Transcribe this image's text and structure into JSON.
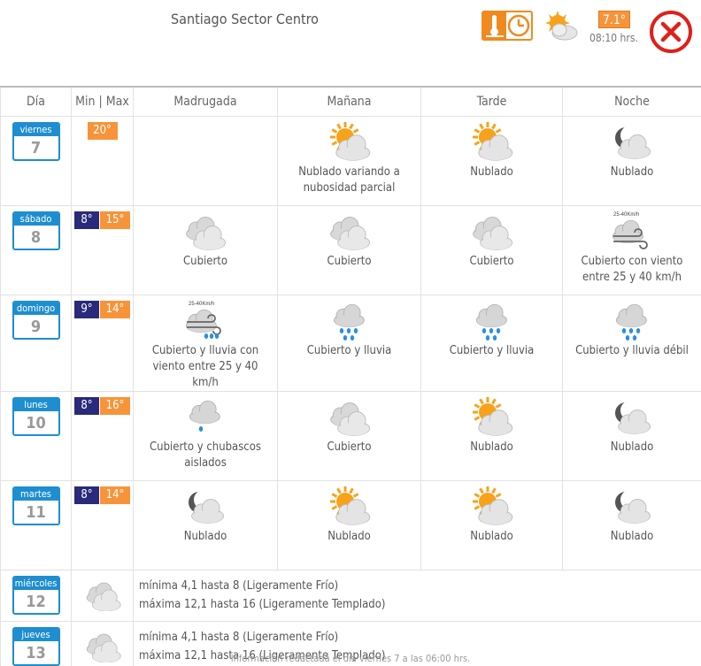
{
  "header": {
    "station": "Santiago Sector Centro",
    "current_temp": "7.1°",
    "current_time": "08:10 hrs.",
    "icons": {
      "temp_clock": "thermometer-clock-icon",
      "current": "partly-cloudy-icon",
      "close": "close-icon"
    }
  },
  "columns": [
    "Día",
    "Min | Max",
    "Madrugada",
    "Mañana",
    "Tarde",
    "Noche"
  ],
  "days": [
    {
      "name": "viernes",
      "date": "7",
      "min": "",
      "max": "20°",
      "periods": [
        {
          "icon": "",
          "text": ""
        },
        {
          "icon": "partly-cloudy",
          "text": "Nublado variando a nubosidad parcial"
        },
        {
          "icon": "partly-cloudy",
          "text": "Nublado"
        },
        {
          "icon": "cloudy-night",
          "text": "Nublado"
        }
      ]
    },
    {
      "name": "sábado",
      "date": "8",
      "min": "8°",
      "max": "15°",
      "periods": [
        {
          "icon": "overcast",
          "text": "Cubierto"
        },
        {
          "icon": "overcast",
          "text": "Cubierto"
        },
        {
          "icon": "overcast",
          "text": "Cubierto"
        },
        {
          "icon": "wind",
          "text": "Cubierto con viento entre 25 y 40 km/h",
          "wind": "25-40Km/h"
        }
      ]
    },
    {
      "name": "domingo",
      "date": "9",
      "min": "9°",
      "max": "14°",
      "periods": [
        {
          "icon": "wind-rain",
          "text": "Cubierto y lluvia con viento entre 25 y 40 km/h",
          "wind": "25-40Km/h"
        },
        {
          "icon": "rain",
          "text": "Cubierto y lluvia"
        },
        {
          "icon": "rain",
          "text": "Cubierto y lluvia"
        },
        {
          "icon": "rain",
          "text": "Cubierto y lluvia débil"
        }
      ]
    },
    {
      "name": "lunes",
      "date": "10",
      "min": "8°",
      "max": "16°",
      "periods": [
        {
          "icon": "showers",
          "text": "Cubierto y chubascos aislados"
        },
        {
          "icon": "overcast",
          "text": "Cubierto"
        },
        {
          "icon": "partly-cloudy",
          "text": "Nublado"
        },
        {
          "icon": "cloudy-night",
          "text": "Nublado"
        }
      ]
    },
    {
      "name": "martes",
      "date": "11",
      "min": "8°",
      "max": "14°",
      "periods": [
        {
          "icon": "cloudy-night",
          "text": "Nublado"
        },
        {
          "icon": "partly-cloudy",
          "text": "Nublado"
        },
        {
          "icon": "partly-cloudy",
          "text": "Nublado"
        },
        {
          "icon": "cloudy-night",
          "text": "Nublado"
        }
      ]
    }
  ],
  "long_range": [
    {
      "name": "miércoles",
      "date": "12",
      "icon": "overcast-small",
      "line1": "mínima 4,1 hasta 8 (Ligeramente Frío)",
      "line2": "máxima 12,1 hasta 16 (Ligeramente Templado)"
    },
    {
      "name": "jueves",
      "date": "13",
      "icon": "overcast-small",
      "line1": "mínima 4,1 hasta 8 (Ligeramente Frío)",
      "line2": "máxima 12,1 hasta 16 (Ligeramente Templado)"
    }
  ],
  "footer": "Información redactada el día viernes 7 a las 06:00 hrs.",
  "colors": {
    "day_blue": "#1e8ed0",
    "max_orange": "#f7943a",
    "min_navy": "#2a2a7a",
    "close_red": "#e0201b"
  }
}
